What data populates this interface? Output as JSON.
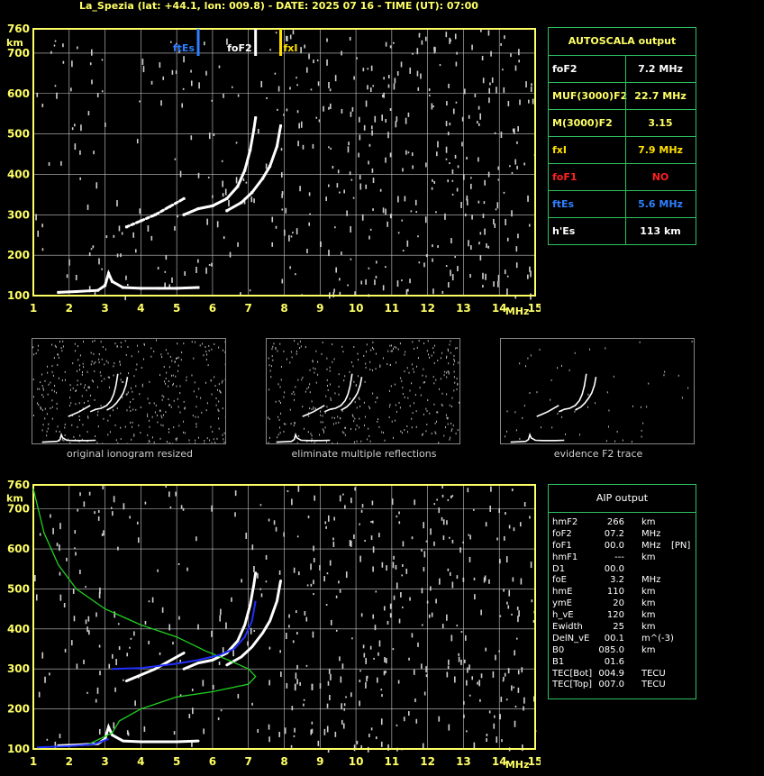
{
  "header": {
    "title": "La_Spezia (lat: +44.1, lon: 009.8) - DATE: 2025 07 16 - TIME (UT): 07:00"
  },
  "colors": {
    "frame": "#ffff66",
    "grid": "#c8c8c8",
    "panel_border": "#30c060",
    "fof2": "#ffffff",
    "fxi": "#ffe000",
    "ftes": "#2f7fff",
    "fof1": "#ff2020",
    "profile": "#20d020",
    "trace_fit": "#2030ff"
  },
  "ionogram_axes": {
    "y_unit": "km",
    "x_unit": "MHz",
    "y_ticks": [
      "760",
      "700",
      "600",
      "500",
      "400",
      "300",
      "200",
      "100"
    ],
    "x_ticks": [
      "1",
      "2",
      "3",
      "4",
      "5",
      "6",
      "7",
      "8",
      "9",
      "10",
      "11",
      "12",
      "13",
      "14",
      "15"
    ]
  },
  "chart_data": [
    {
      "type": "scatter",
      "chart": "top-ionogram",
      "xlim": [
        1,
        15
      ],
      "ylim": [
        100,
        760
      ],
      "xlabel": "MHz",
      "ylabel": "km",
      "markers": [
        {
          "label": "ftEs",
          "x": 5.6,
          "color": "#2f7fff"
        },
        {
          "label": "foF2",
          "x": 7.2,
          "color": "#ffffff"
        },
        {
          "label": "fxI",
          "x": 7.9,
          "color": "#ffe000"
        }
      ],
      "series": [
        {
          "name": "",
          "points": [
            [
              1.7,
              108
            ],
            [
              2.2,
              110
            ],
            [
              2.8,
              113
            ],
            [
              3.0,
              125
            ],
            [
              3.1,
              155
            ],
            [
              3.2,
              135
            ],
            [
              3.5,
              120
            ],
            [
              4.0,
              118
            ],
            [
              4.5,
              118
            ],
            [
              5.0,
              118
            ],
            [
              5.6,
              120
            ]
          ]
        },
        {
          "name": "",
          "points": [
            [
              5.2,
              300
            ],
            [
              5.6,
              315
            ],
            [
              6.0,
              322
            ],
            [
              6.4,
              340
            ],
            [
              6.7,
              370
            ],
            [
              6.9,
              410
            ],
            [
              7.05,
              460
            ],
            [
              7.15,
              510
            ],
            [
              7.2,
              540
            ]
          ]
        },
        {
          "name": "",
          "points": [
            [
              6.4,
              310
            ],
            [
              6.8,
              330
            ],
            [
              7.1,
              355
            ],
            [
              7.4,
              390
            ],
            [
              7.6,
              420
            ],
            [
              7.8,
              470
            ],
            [
              7.9,
              520
            ]
          ]
        },
        {
          "name": "",
          "points": [
            [
              3.6,
              270
            ],
            [
              4.0,
              285
            ],
            [
              4.4,
              300
            ],
            [
              4.8,
              320
            ],
            [
              5.2,
              340
            ]
          ]
        }
      ]
    },
    {
      "type": "line",
      "chart": "bottom-ionogram",
      "xlim": [
        1,
        15
      ],
      "ylim": [
        100,
        760
      ],
      "xlabel": "MHz",
      "ylabel": "km",
      "series": [
        {
          "name": "",
          "points": [
            [
              1.0,
              750
            ],
            [
              1.3,
              640
            ],
            [
              1.7,
              560
            ],
            [
              2.2,
              500
            ],
            [
              3.0,
              450
            ],
            [
              4.0,
              410
            ],
            [
              5.0,
              380
            ],
            [
              5.8,
              345
            ],
            [
              6.5,
              320
            ],
            [
              7.0,
              300
            ],
            [
              7.2,
              281
            ],
            [
              7.0,
              262
            ],
            [
              6.0,
              243
            ],
            [
              5.0,
              230
            ],
            [
              4.0,
              200
            ],
            [
              3.4,
              170
            ],
            [
              3.2,
              140
            ],
            [
              2.5,
              110
            ],
            [
              1.2,
              104
            ]
          ]
        },
        {
          "name": "",
          "points": [
            [
              3.2,
              300
            ],
            [
              4.0,
              302
            ],
            [
              5.0,
              313
            ],
            [
              5.6,
              322
            ],
            [
              6.2,
              335
            ],
            [
              6.6,
              350
            ],
            [
              6.9,
              380
            ],
            [
              7.1,
              420
            ],
            [
              7.2,
              470
            ]
          ]
        },
        {
          "name": "",
          "points": [
            [
              1.1,
              104
            ],
            [
              2.0,
              107
            ],
            [
              2.7,
              112
            ],
            [
              3.1,
              125
            ]
          ]
        }
      ]
    }
  ],
  "autoscala": {
    "title": "AUTOSCALA output",
    "rows": [
      {
        "key": "foF2",
        "value": "7.2 MHz",
        "kc": "#ffffff",
        "vc": "#ffffff"
      },
      {
        "key": "MUF(3000)F2",
        "value": "22.7 MHz",
        "kc": "#ffff66",
        "vc": "#ffff66"
      },
      {
        "key": "M(3000)F2",
        "value": "3.15",
        "kc": "#ffff66",
        "vc": "#ffff66"
      },
      {
        "key": "fxI",
        "value": "7.9 MHz",
        "kc": "#ffe000",
        "vc": "#ffe000"
      },
      {
        "key": "foF1",
        "value": "NO",
        "kc": "#ff2020",
        "vc": "#ff2020"
      },
      {
        "key": "ftEs",
        "value": "5.6 MHz",
        "kc": "#2f7fff",
        "vc": "#2f7fff"
      },
      {
        "key": "h'Es",
        "value": "113    km",
        "kc": "#ffffff",
        "vc": "#ffffff"
      }
    ]
  },
  "thumbnails": {
    "captions": [
      "original ionogram resized",
      "eliminate multiple reflections",
      "evidence F2 trace"
    ]
  },
  "aip": {
    "title": "AIP output",
    "rows": [
      {
        "k": "hmF2",
        "v": "266",
        "u": "km",
        "x": ""
      },
      {
        "k": "foF2",
        "v": "07.2",
        "u": "MHz",
        "x": ""
      },
      {
        "k": "foF1",
        "v": "00.0",
        "u": "MHz",
        "x": "[PN]"
      },
      {
        "k": "hmF1",
        "v": "---",
        "u": "km",
        "x": ""
      },
      {
        "k": "D1",
        "v": "00.0",
        "u": "",
        "x": ""
      },
      {
        "k": "foE",
        "v": "3.2",
        "u": "MHz",
        "x": ""
      },
      {
        "k": "hmE",
        "v": "110",
        "u": "km",
        "x": ""
      },
      {
        "k": "ymE",
        "v": "20",
        "u": "km",
        "x": ""
      },
      {
        "k": "h_vE",
        "v": "120",
        "u": "km",
        "x": ""
      },
      {
        "k": "Ewidth",
        "v": "25",
        "u": "km",
        "x": ""
      },
      {
        "k": "DelN_vE",
        "v": "00.1",
        "u": "m^(-3)",
        "x": ""
      },
      {
        "k": "B0",
        "v": "085.0",
        "u": "km",
        "x": ""
      },
      {
        "k": "B1",
        "v": "01.6",
        "u": "",
        "x": ""
      },
      {
        "k": "TEC[Bot]",
        "v": "004.9",
        "u": "TECU",
        "x": ""
      },
      {
        "k": "TEC[Top]",
        "v": "007.0",
        "u": "TECU",
        "x": ""
      }
    ]
  }
}
